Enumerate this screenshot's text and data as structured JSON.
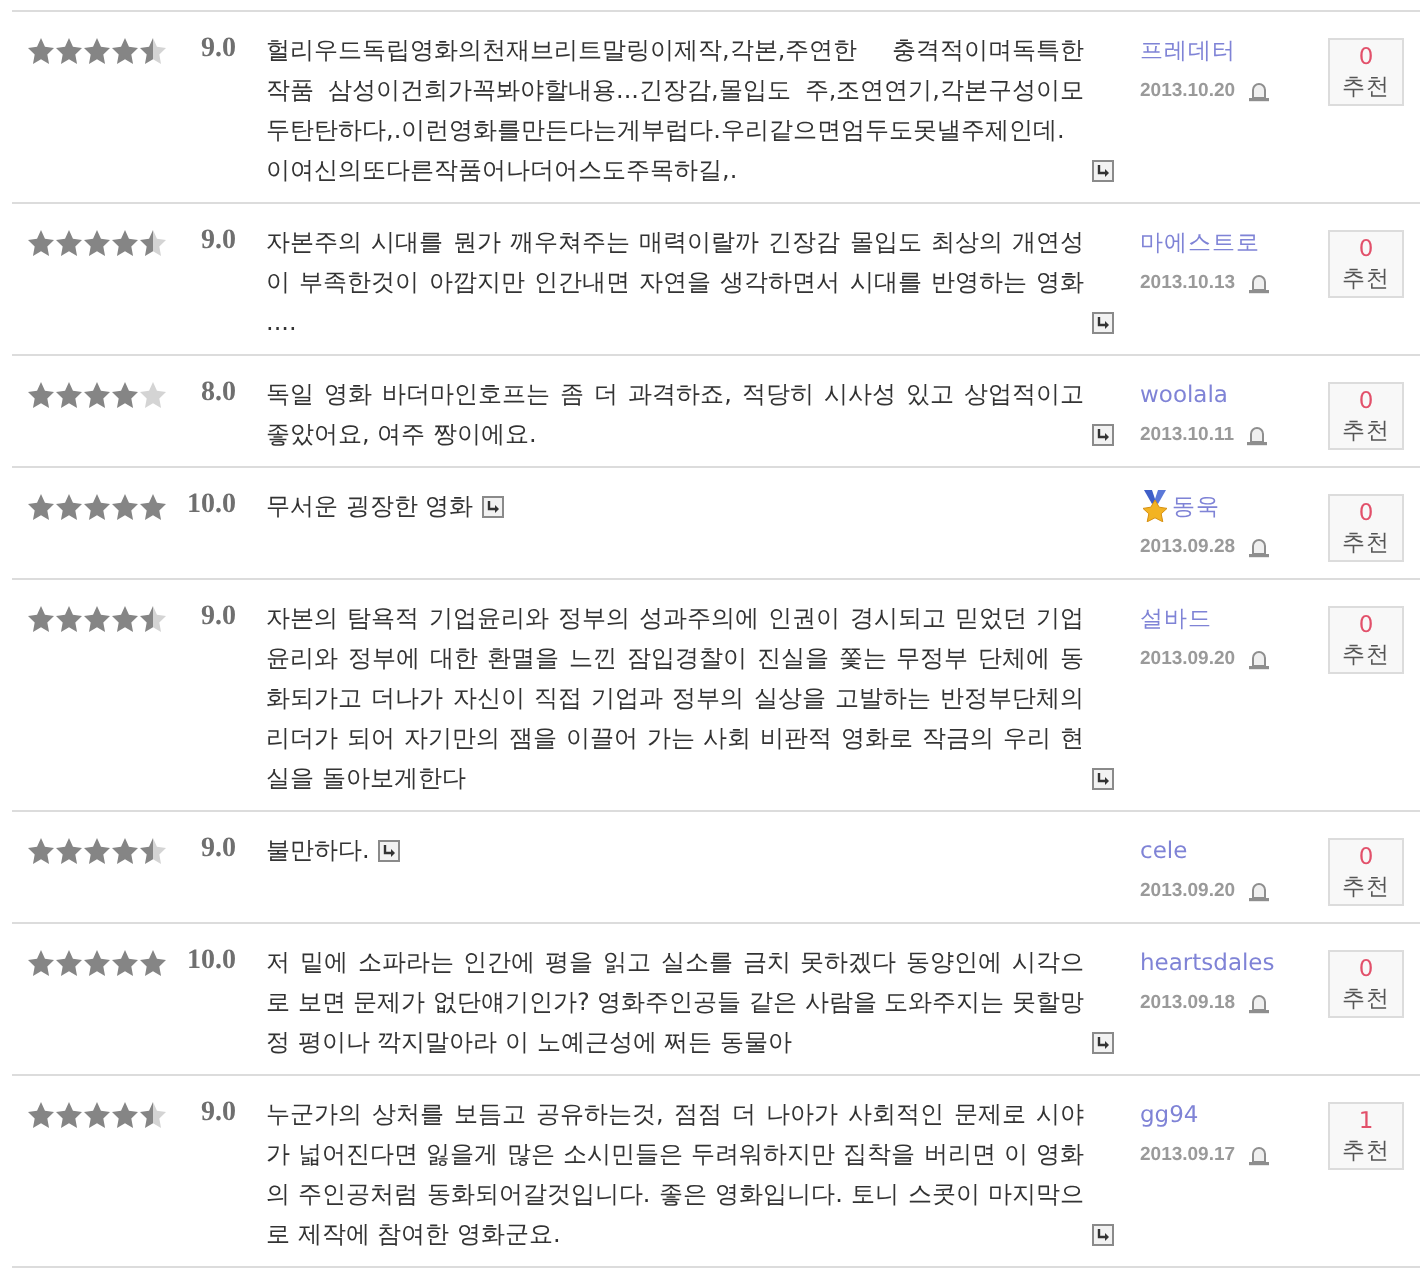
{
  "reviews": [
    {
      "stars": 4.5,
      "score": "9.0",
      "text": "헐리우드독립영화의천재브리트말링이제작,각본,주연한 충격적이며독특한 작품 삼성이건희가꼭봐야할내용...긴장감,몰입도 주,조연연기,각본구성이모두탄탄하다,.이런영화를만든다는게부럽다.우리같으면엄두도못낼주제인데.이여신의또다른작품어나더어스도주목하길,.",
      "author": "프레데터",
      "medal": false,
      "date": "2013.10.20",
      "recommend_count": "0",
      "recommend_label": "추천"
    },
    {
      "stars": 4.5,
      "score": "9.0",
      "text": "자본주의 시대를 뭔가 깨우쳐주는 매력이랄까 긴장감 몰입도 최상의 개연성이 부족한것이 아깝지만 인간내면 자연을 생각하면서 시대를 반영하는 영화 ....",
      "author": "마에스트로",
      "medal": false,
      "date": "2013.10.13",
      "recommend_count": "0",
      "recommend_label": "추천"
    },
    {
      "stars": 4,
      "score": "8.0",
      "text": "독일 영화 바더마인호프는 좀 더 과격하죠, 적당히 시사성 있고 상업적이고 좋았어요, 여주 짱이에요.",
      "author": "woolala",
      "medal": false,
      "date": "2013.10.11",
      "recommend_count": "0",
      "recommend_label": "추천"
    },
    {
      "stars": 5,
      "score": "10.0",
      "text": "무서운 굉장한 영화",
      "author": "동욱",
      "medal": true,
      "date": "2013.09.28",
      "recommend_count": "0",
      "recommend_label": "추천"
    },
    {
      "stars": 4.5,
      "score": "9.0",
      "text": "자본의 탐욕적 기업윤리와 정부의 성과주의에 인권이 경시되고 믿었던 기업윤리와 정부에 대한 환멸을 느낀 잠입경찰이 진실을 쫓는 무정부 단체에 동화되가고 더나가 자신이 직접 기업과 정부의 실상을 고발하는 반정부단체의 리더가 되어 자기만의 잼을 이끌어 가는 사회 비판적 영화로 작금의 우리 현실을 돌아보게한다",
      "author": "설바드",
      "medal": false,
      "date": "2013.09.20",
      "recommend_count": "0",
      "recommend_label": "추천"
    },
    {
      "stars": 4.5,
      "score": "9.0",
      "text": "불만하다.",
      "author": "cele",
      "medal": false,
      "date": "2013.09.20",
      "recommend_count": "0",
      "recommend_label": "추천"
    },
    {
      "stars": 5,
      "score": "10.0",
      "text": "저 밑에 소파라는 인간에 평을 읽고 실소를 금치 못하겠다 동양인에 시각으로 보면 문제가 없단얘기인가? 영화주인공들 같은 사람을 도와주지는 못할망정 평이나 깍지말아라 이 노예근성에 쩌든 동물아",
      "author": "heartsdales",
      "medal": false,
      "date": "2013.09.18",
      "recommend_count": "0",
      "recommend_label": "추천"
    },
    {
      "stars": 4.5,
      "score": "9.0",
      "text": "누군가의 상처를 보듬고 공유하는것, 점점 더 나아가 사회적인 문제로 시야가 넓어진다면 잃을게 많은 소시민들은 두려워하지만 집착을 버리면 이 영화의 주인공처럼 동화되어갈것입니다. 좋은 영화입니다. 토니 스콧이 마지막으로 제작에 참여한 영화군요.",
      "author": "gg94",
      "medal": false,
      "date": "2013.09.17",
      "recommend_count": "1",
      "recommend_label": "추천"
    }
  ]
}
